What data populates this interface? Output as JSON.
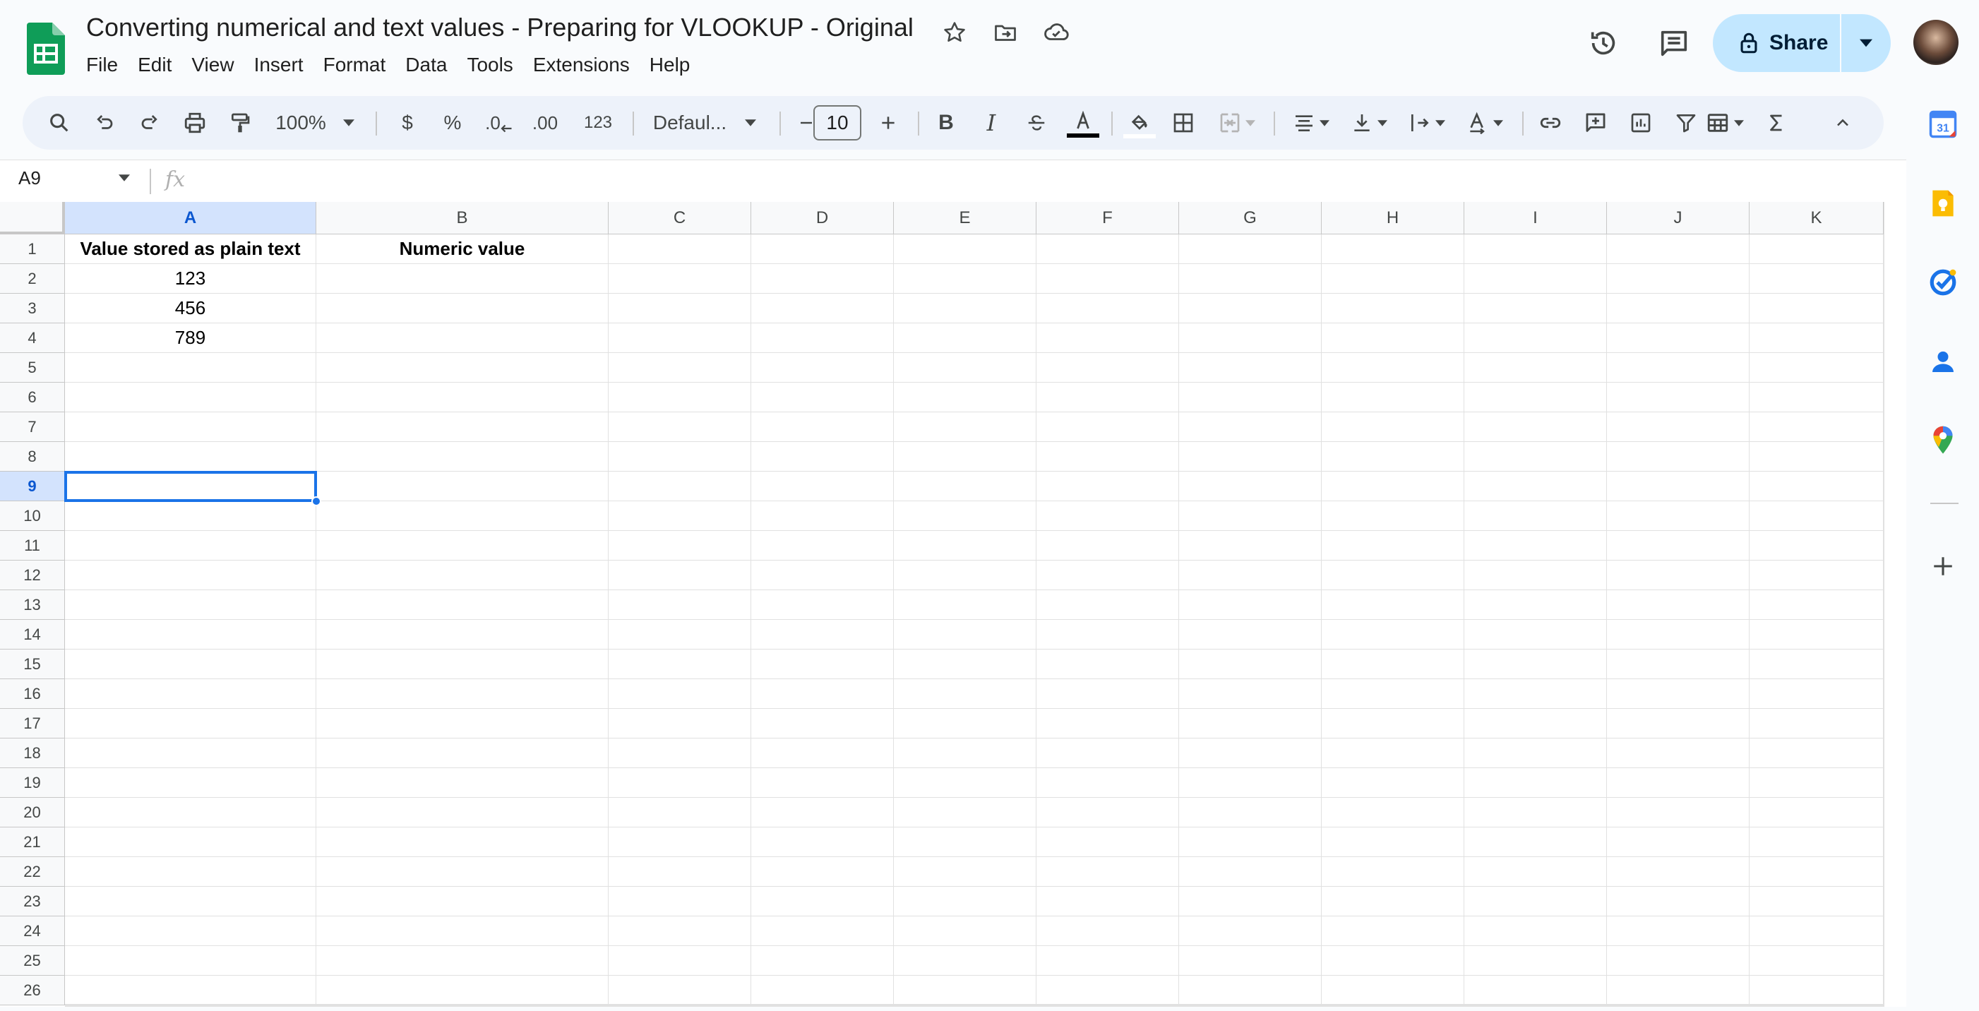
{
  "doc": {
    "title": "Converting numerical and text values - Preparing for VLOOKUP - Original"
  },
  "menu": [
    "File",
    "Edit",
    "View",
    "Insert",
    "Format",
    "Data",
    "Tools",
    "Extensions",
    "Help"
  ],
  "share": {
    "label": "Share"
  },
  "toolbar": {
    "zoom": "100%",
    "currency": "$",
    "percent": "%",
    "decrease_decimal": ".0",
    "increase_decimal": ".00",
    "more_formats": "123",
    "font": "Defaul...",
    "font_size": "10",
    "bold": "B",
    "italic": "I"
  },
  "formula_bar": {
    "name_box": "A9",
    "fx": "fx",
    "value": ""
  },
  "grid": {
    "columns": [
      "A",
      "B",
      "C",
      "D",
      "E",
      "F",
      "G",
      "H",
      "I",
      "J",
      "K"
    ],
    "rows": [
      "1",
      "2",
      "3",
      "4",
      "5",
      "6",
      "7",
      "8",
      "9",
      "10",
      "11",
      "12",
      "13",
      "14",
      "15",
      "16",
      "17",
      "18",
      "19",
      "20",
      "21",
      "22",
      "23",
      "24",
      "25",
      "26"
    ],
    "selected_cell": "A9",
    "cells": {
      "A1": "Value stored as plain text",
      "B1": "Numeric value",
      "A2": "123",
      "A3": "456",
      "A4": "789"
    }
  },
  "side_panel": {
    "calendar_day": "31"
  },
  "colors": {
    "accent": "#1a73e8",
    "share_bg": "#c2e7ff",
    "toolbar_bg": "#edf2fa",
    "sheets_green": "#0f9d58"
  }
}
